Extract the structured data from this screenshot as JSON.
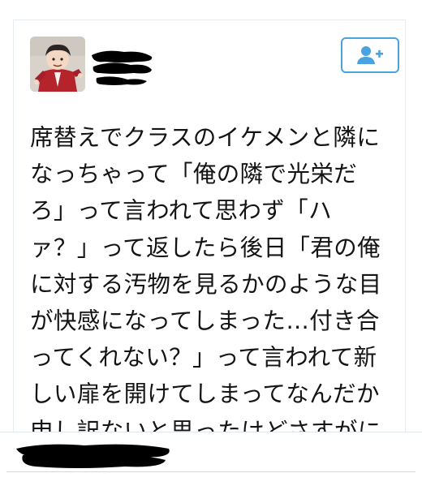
{
  "tweet": {
    "text": "席替えでクラスのイケメンと隣に\nなっちゃって「俺の隣で光栄だ\nろ」って言われて思わず「ハ\nァ？」って返したら後日「君の俺\nに対する汚物を見るかのような目\nが快感になってしまった…付き合\nってくれない？」って言われて新\nしい扉を開けてしまってなんだか\n申し訳ないと思ったけどさすがに\n断った。"
  },
  "icons": {
    "follow": "add-user-icon"
  },
  "colors": {
    "accent": "#4aa3df",
    "text": "#141414",
    "divider": "#e1e8ed"
  }
}
